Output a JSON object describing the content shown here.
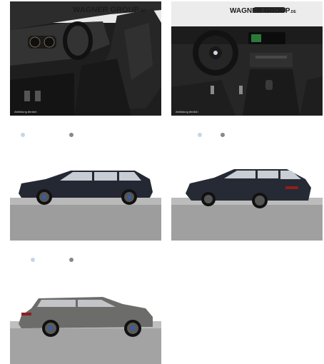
{
  "gallery": {
    "dealer_brand": "WAGNER GROUP",
    "dealer_suffix": ".DE",
    "images": [
      {
        "view": "interior-driver-seat",
        "caption": "Abbildung ähnlich"
      },
      {
        "view": "interior-dashboard",
        "caption": "Abbildung ähnlich"
      },
      {
        "view": "exterior-side-left-dark",
        "caption": ""
      },
      {
        "view": "exterior-rear-three-quarter-dark",
        "caption": ""
      },
      {
        "view": "exterior-side-left-grey",
        "caption": ""
      }
    ]
  },
  "colors": {
    "car_dark": "#262a33",
    "car_grey": "#6c6c6a",
    "interior": "#2a2a2a",
    "floor": "#aaaaaa",
    "studio_wall": "#ffffff",
    "brake_blue": "#2a5fc8"
  }
}
